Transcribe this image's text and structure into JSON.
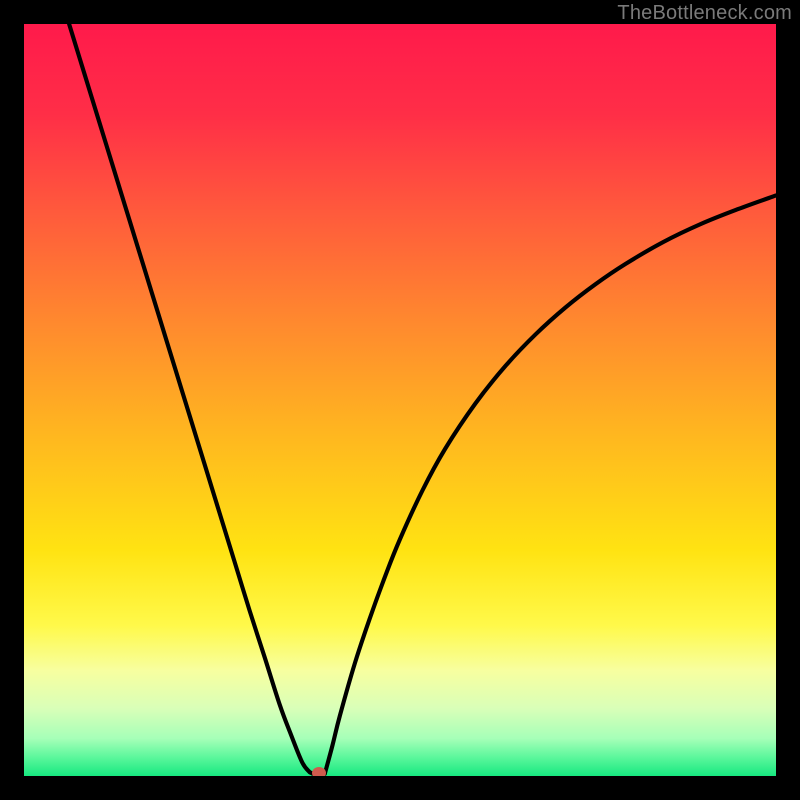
{
  "watermark": "TheBottleneck.com",
  "chart_data": {
    "type": "line",
    "title": "",
    "xlabel": "",
    "ylabel": "",
    "xlim": [
      0,
      100
    ],
    "ylim": [
      0,
      100
    ],
    "grid": false,
    "legend": null,
    "gradient_stops": [
      {
        "offset": 0.0,
        "color": "#ff1a4b"
      },
      {
        "offset": 0.12,
        "color": "#ff2e47"
      },
      {
        "offset": 0.25,
        "color": "#ff5a3c"
      },
      {
        "offset": 0.4,
        "color": "#ff8a2e"
      },
      {
        "offset": 0.55,
        "color": "#ffb81f"
      },
      {
        "offset": 0.7,
        "color": "#ffe312"
      },
      {
        "offset": 0.8,
        "color": "#fff94a"
      },
      {
        "offset": 0.86,
        "color": "#f7ffa0"
      },
      {
        "offset": 0.91,
        "color": "#d9ffb8"
      },
      {
        "offset": 0.95,
        "color": "#a6ffb8"
      },
      {
        "offset": 0.975,
        "color": "#5cf79c"
      },
      {
        "offset": 1.0,
        "color": "#17e880"
      }
    ],
    "series": [
      {
        "name": "bottleneck-curve",
        "color": "#000000",
        "x": [
          6,
          8,
          10,
          12,
          14,
          16,
          18,
          20,
          22,
          24,
          26,
          28,
          30,
          32,
          34,
          35.5,
          37,
          38,
          38.4,
          39.5,
          40.0,
          41,
          42,
          44,
          46,
          48,
          50,
          53,
          56,
          60,
          64,
          68,
          72,
          76,
          80,
          85,
          90,
          95,
          100
        ],
        "y": [
          100,
          93.5,
          87,
          80.5,
          74,
          67.5,
          61,
          54.5,
          48,
          41.5,
          35,
          28.5,
          22,
          15.8,
          9.5,
          5.5,
          1.8,
          0.5,
          0.3,
          0.3,
          0.3,
          4,
          8,
          15,
          21,
          26.5,
          31.5,
          38,
          43.5,
          49.5,
          54.5,
          58.7,
          62.3,
          65.4,
          68.1,
          71,
          73.4,
          75.4,
          77.2
        ]
      }
    ],
    "marker": {
      "x": 39.2,
      "y": 0.4,
      "color": "#cf5a4d"
    },
    "annotations": []
  }
}
